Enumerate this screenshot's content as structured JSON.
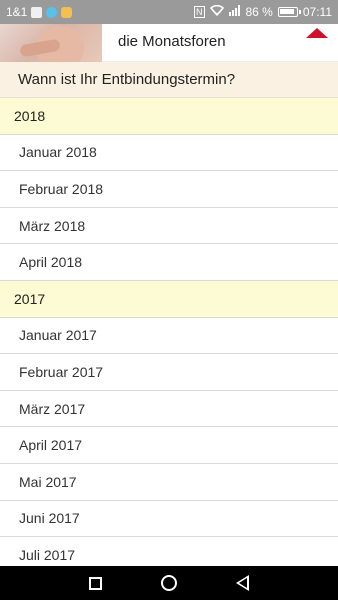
{
  "status_bar": {
    "carrier": "1&1",
    "battery_text": "86 %",
    "time": "07:11",
    "icons": [
      "app-icon-1",
      "app-icon-2",
      "app-icon-3",
      "nfc-icon",
      "wifi-icon",
      "signal-icon",
      "battery-icon"
    ]
  },
  "banner": {
    "text": "die Monatsforen",
    "arrow_color": "#d0112b"
  },
  "question": {
    "label": "Wann ist Ihr Entbindungstermin?"
  },
  "groups": [
    {
      "year": "2018",
      "months": [
        "Januar 2018",
        "Februar 2018",
        "März 2018",
        "April 2018"
      ]
    },
    {
      "year": "2017",
      "months": [
        "Januar 2017",
        "Februar 2017",
        "März 2017",
        "April 2017",
        "Mai 2017",
        "Juni 2017",
        "Juli 2017"
      ]
    }
  ],
  "nav_bar": {
    "buttons": [
      "recent-apps-icon",
      "home-icon",
      "back-icon"
    ]
  },
  "colors": {
    "year_header_bg": "#fdfbd3",
    "question_bg": "#fbf1e2",
    "status_bar_bg": "#9a9a9a"
  }
}
